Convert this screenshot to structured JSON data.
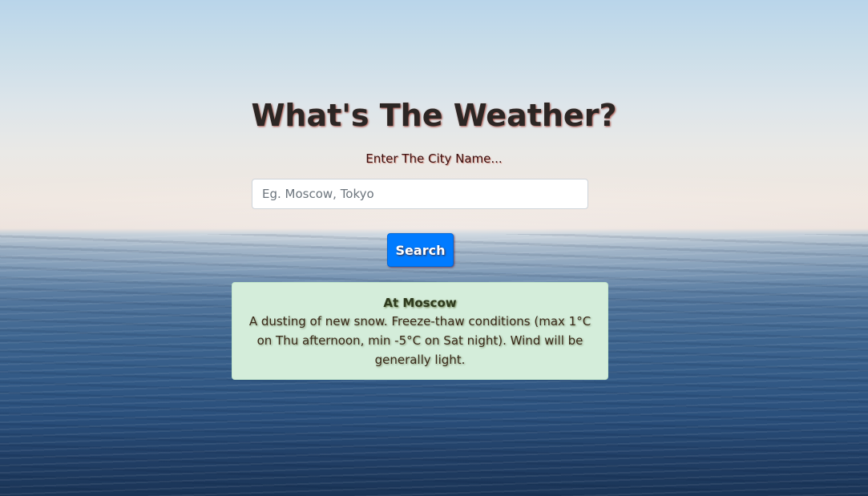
{
  "page": {
    "title": "What's The Weather?",
    "subtitle": "Enter The City Name..."
  },
  "search": {
    "placeholder": "Eg. Moscow, Tokyo",
    "value": "",
    "button_label": "Search"
  },
  "result": {
    "heading": "At Moscow",
    "text": "A dusting of new snow. Freeze-thaw conditions (max 1°C on Thu afternoon, min -5°C on Sat night). Wind will be generally light."
  },
  "colors": {
    "button": "#007bff",
    "result_background": "#d4edda"
  }
}
